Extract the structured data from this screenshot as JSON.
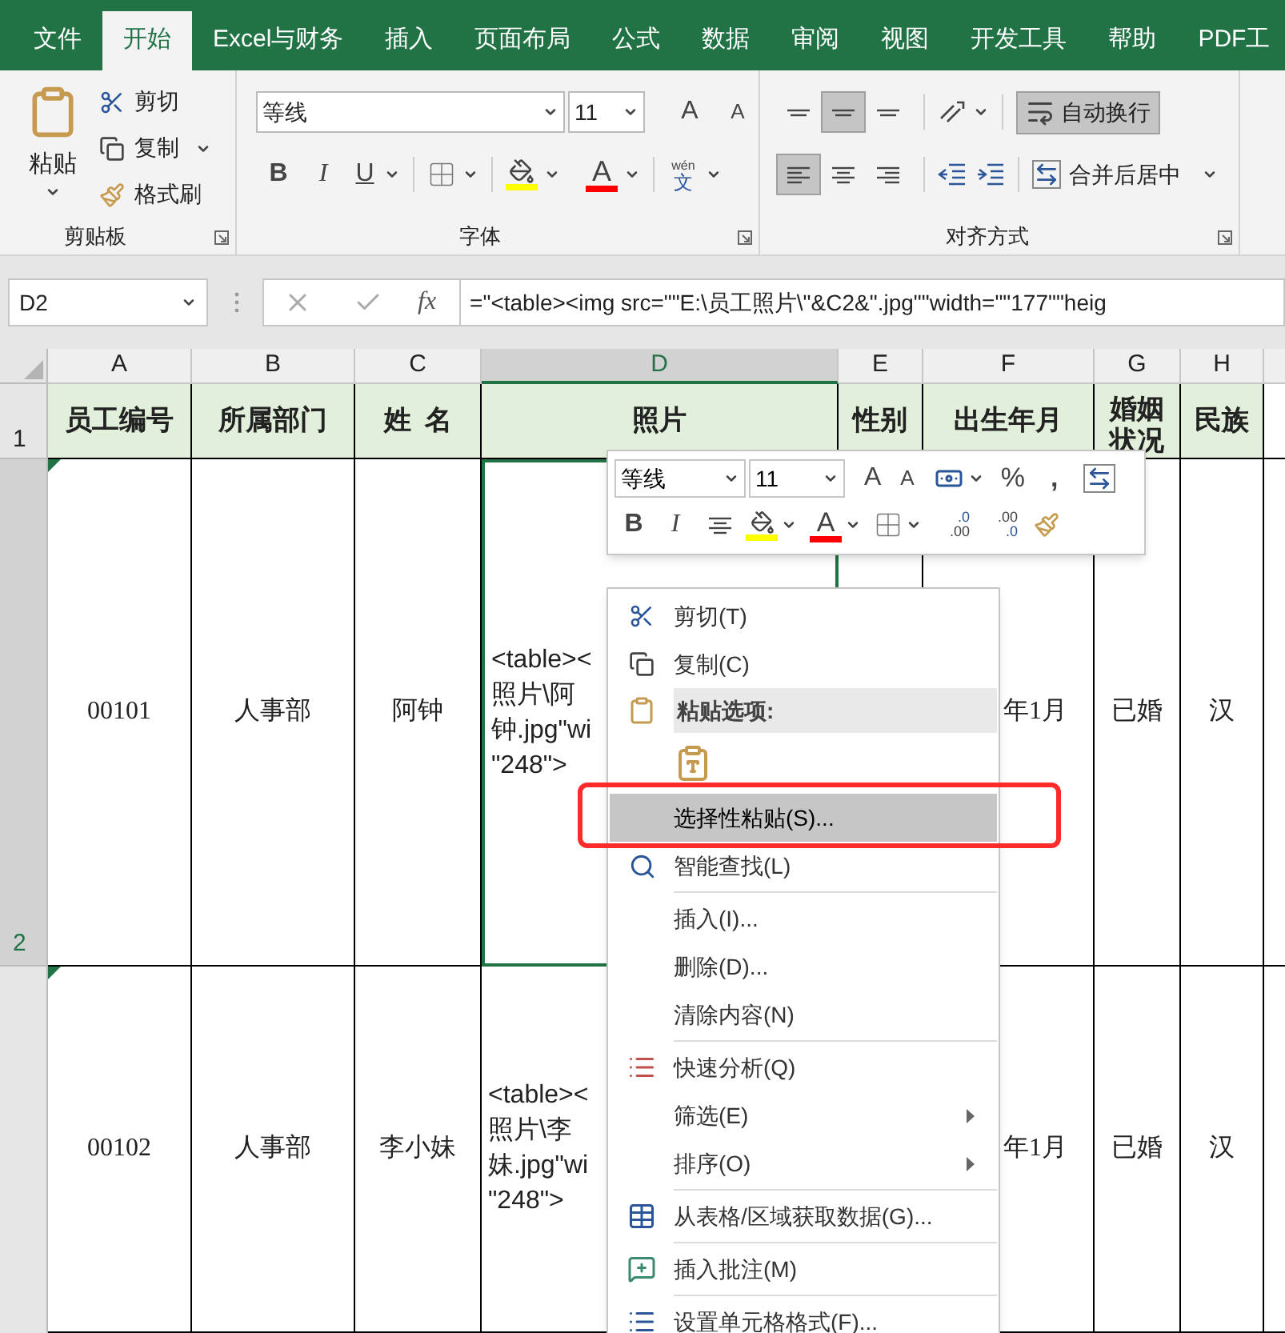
{
  "tabs": [
    {
      "label": "文件",
      "selected": false
    },
    {
      "label": "开始",
      "selected": true
    },
    {
      "label": "Excel与财务",
      "selected": false
    },
    {
      "label": "插入",
      "selected": false
    },
    {
      "label": "页面布局",
      "selected": false
    },
    {
      "label": "公式",
      "selected": false
    },
    {
      "label": "数据",
      "selected": false
    },
    {
      "label": "审阅",
      "selected": false
    },
    {
      "label": "视图",
      "selected": false
    },
    {
      "label": "开发工具",
      "selected": false
    },
    {
      "label": "帮助",
      "selected": false
    },
    {
      "label": "PDF工",
      "selected": false
    }
  ],
  "ribbon": {
    "clipboard": {
      "title": "剪贴板",
      "paste": "粘贴",
      "cut": "剪切",
      "copy": "复制",
      "format_painter": "格式刷"
    },
    "font": {
      "title": "字体",
      "font_name": "等线",
      "font_size": "11",
      "grow": "A",
      "shrink": "A",
      "bold": "B",
      "italic": "I",
      "underline": "U",
      "font_color": "A",
      "phonetic_top": "wén",
      "phonetic_bottom": "文"
    },
    "alignment": {
      "title": "对齐方式",
      "vertical": [
        {
          "selected": false
        },
        {
          "selected": true
        },
        {
          "selected": false
        }
      ],
      "horizontal": [
        {
          "selected": true
        },
        {
          "selected": false
        },
        {
          "selected": false
        }
      ],
      "wrap_text": {
        "label": "自动换行",
        "selected": true
      },
      "merge": "合并后居中"
    }
  },
  "formula_bar": {
    "name_box": "D2",
    "fx": "fx",
    "formula": "=\"<table><img src=\"\"E:\\员工照片\\\"&C2&\".jpg\"\"width=\"\"177\"\"heig"
  },
  "sheet": {
    "columns": [
      {
        "label": "A",
        "selected": false
      },
      {
        "label": "B",
        "selected": false
      },
      {
        "label": "C",
        "selected": false
      },
      {
        "label": "D",
        "selected": true
      },
      {
        "label": "E",
        "selected": false
      },
      {
        "label": "F",
        "selected": false
      },
      {
        "label": "G",
        "selected": false
      },
      {
        "label": "H",
        "selected": false
      }
    ],
    "header_row": {
      "number": "1",
      "cells": [
        "员工编号",
        "所属部门",
        "姓  名",
        "照片",
        "性别",
        "出生年月",
        "婚姻状况",
        "民族"
      ]
    },
    "rows": [
      {
        "number": "2",
        "selected": true,
        "flagged": true,
        "cells": [
          "00101",
          "人事部",
          "阿钟",
          [
            "<table><",
            "照片\\阿",
            "钟.jpg\"wi",
            "\"248\">"
          ],
          "",
          "年1月",
          "已婚",
          "汉"
        ]
      },
      {
        "selected": false,
        "flagged": true,
        "cells": [
          "00102",
          "人事部",
          "李小妹",
          [
            "<table><",
            "照片\\李",
            "妹.jpg\"wi",
            "\"248\">"
          ],
          "",
          "年1月",
          "已婚",
          "汉"
        ]
      }
    ]
  },
  "mini_toolbar": {
    "font_name": "等线",
    "font_size": "11",
    "grow": "A",
    "shrink": "A",
    "percent": "%",
    "comma": ",",
    "bold": "B",
    "italic": "I",
    "font_color": "A",
    "increase_decimal": [
      ".0",
      ".00"
    ],
    "decrease_decimal": [
      ".00",
      ".0"
    ]
  },
  "context_menu": [
    {
      "kind": "cut",
      "label": "剪切(T)",
      "selected": false,
      "outlined": false,
      "separator_after": false
    },
    {
      "kind": "copy",
      "label": "复制(C)",
      "selected": false,
      "outlined": false,
      "separator_after": false
    },
    {
      "kind": "header",
      "label": "粘贴选项:",
      "selected": false,
      "outlined": false
    },
    {
      "kind": "paste-option",
      "selected": false,
      "outlined": false
    },
    {
      "kind": "plain",
      "label": "选择性粘贴(S)...",
      "selected": true,
      "outlined": true,
      "separator_after": false
    },
    {
      "kind": "lookup",
      "label": "智能查找(L)",
      "selected": false,
      "outlined": false,
      "separator_after": true
    },
    {
      "kind": "plain",
      "label": "插入(I)...",
      "selected": false,
      "outlined": false,
      "separator_after": false
    },
    {
      "kind": "plain",
      "label": "删除(D)...",
      "selected": false,
      "outlined": false,
      "separator_after": false
    },
    {
      "kind": "plain",
      "label": "清除内容(N)",
      "selected": false,
      "outlined": false,
      "separator_after": true
    },
    {
      "kind": "quick-analysis",
      "label": "快速分析(Q)",
      "selected": false,
      "outlined": false,
      "separator_after": false
    },
    {
      "kind": "submenu",
      "label": "筛选(E)",
      "selected": false,
      "outlined": false,
      "separator_after": false
    },
    {
      "kind": "submenu",
      "label": "排序(O)",
      "selected": false,
      "outlined": false,
      "separator_after": true
    },
    {
      "kind": "get-data",
      "label": "从表格/区域获取数据(G)...",
      "selected": false,
      "outlined": false,
      "separator_after": true
    },
    {
      "kind": "comment",
      "label": "插入批注(M)",
      "selected": false,
      "outlined": false,
      "separator_after": true
    },
    {
      "kind": "format-cells",
      "label": "设置单元格格式(F)...",
      "selected": false,
      "outlined": false,
      "separator_after": false
    }
  ]
}
